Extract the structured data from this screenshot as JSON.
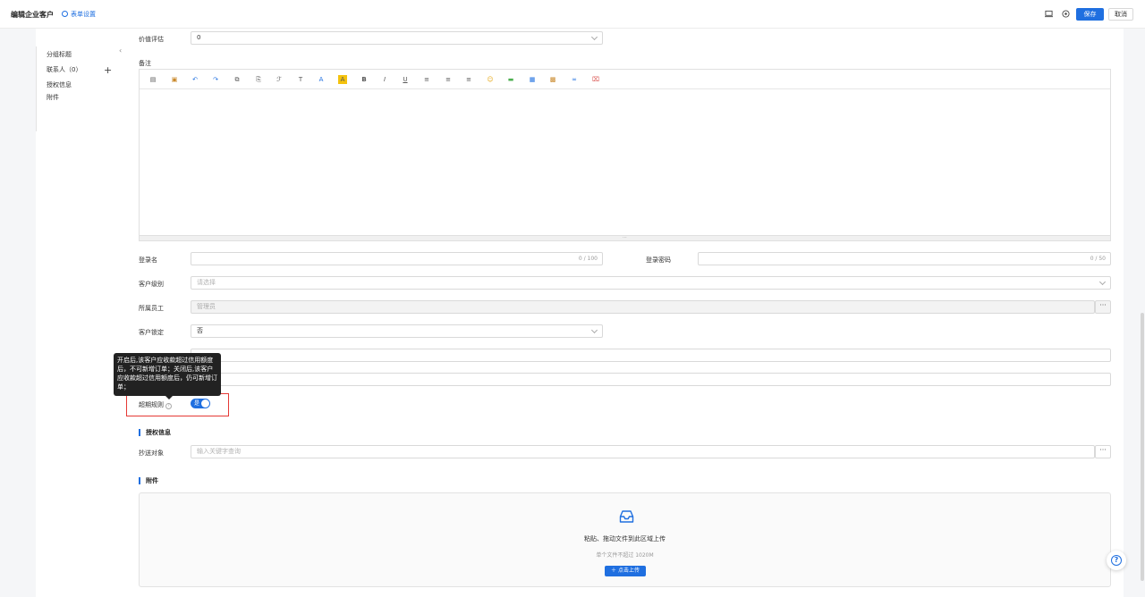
{
  "header": {
    "title": "编辑企业客户",
    "form_settings": "表单设置",
    "save_label": "保存",
    "cancel_label": "取消"
  },
  "sidenav": {
    "items": [
      {
        "label": "分组标题"
      },
      {
        "label": "联系人（0）"
      },
      {
        "label": "授权信息"
      },
      {
        "label": "附件"
      }
    ]
  },
  "form": {
    "value_eval": {
      "label": "价值评估",
      "value": "0"
    },
    "remark": {
      "label": "备注"
    },
    "login_name": {
      "label": "登录名",
      "count": "0 / 100"
    },
    "login_password": {
      "label": "登录密码",
      "count": "0 / 50"
    },
    "customer_level": {
      "label": "客户级别",
      "placeholder": "请选择"
    },
    "staff": {
      "label": "所属员工",
      "value": "管理员"
    },
    "customer_lock": {
      "label": "客户锁定",
      "value": "否"
    },
    "overdue_rule": {
      "label": "超期规则",
      "toggle_text": "是"
    },
    "tooltip": "开启后,该客户应收款超过信用额度后，不可新增订单；关闭后,该客户应收款超过信用额度后，仍可新增订单；"
  },
  "auth_section": {
    "title": "授权信息",
    "cc_label": "抄送对象",
    "cc_placeholder": "输入关键字查询"
  },
  "attachment_section": {
    "title": "附件",
    "drop_text": "粘贴、拖动文件到此区域上传",
    "limit_text": "单个文件不超过 1020M",
    "upload_button": "点击上传"
  },
  "colors": {
    "accent": "#1f6fe0",
    "highlight_border": "#e53935"
  }
}
